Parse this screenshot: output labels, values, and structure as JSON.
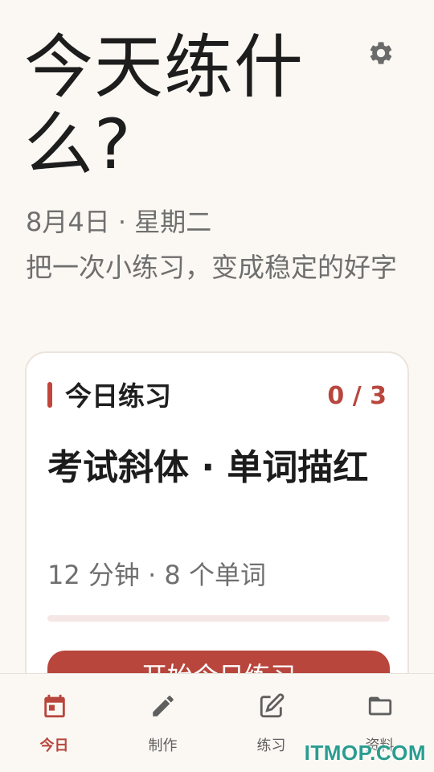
{
  "header": {
    "title": "今天练什么?",
    "date": "8月4日 · 星期二",
    "slogan": "把一次小练习，变成稳定的好字",
    "settings_icon": "gear-icon"
  },
  "today_card": {
    "label": "今日练习",
    "progress_text": "0 / 3",
    "progress_fraction": 0,
    "task_title": "考试斜体 · 单词描红",
    "meta": "12 分钟 · 8 个单词",
    "start_button": "开始今日练习",
    "accent_color": "#c2453c"
  },
  "bottom_nav": {
    "items": [
      {
        "label": "今日",
        "icon": "calendar-icon",
        "active": true
      },
      {
        "label": "制作",
        "icon": "pencil-icon",
        "active": false
      },
      {
        "label": "练习",
        "icon": "edit-square-icon",
        "active": false
      },
      {
        "label": "资料",
        "icon": "folder-icon",
        "active": false
      }
    ]
  },
  "watermark": "ITMOP.COM"
}
